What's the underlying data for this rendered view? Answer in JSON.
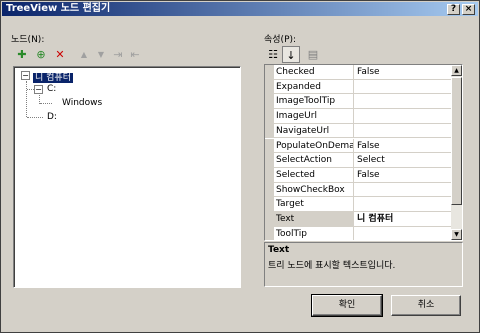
{
  "window": {
    "title": "TreeView 노드 편집기",
    "help_glyph": "?",
    "close_glyph": "×"
  },
  "nodes_panel": {
    "label": "노드(N):",
    "toolbar": [
      {
        "name": "add-root-icon",
        "glyph": "✚"
      },
      {
        "name": "add-child-icon",
        "glyph": "⊕"
      },
      {
        "name": "delete-icon",
        "glyph": "✕"
      },
      {
        "name": "move-up-icon",
        "glyph": "▲"
      },
      {
        "name": "move-down-icon",
        "glyph": "▼"
      },
      {
        "name": "indent-icon",
        "glyph": "⇥"
      },
      {
        "name": "outdent-icon",
        "glyph": "⇤"
      }
    ],
    "tree": {
      "root": "니 컴퓨터",
      "child1": "C:",
      "grandchild": "Windows",
      "child2": "D:"
    }
  },
  "props_panel": {
    "label": "속성(P):",
    "toolbar": [
      {
        "name": "categorized-icon",
        "glyph": "☷"
      },
      {
        "name": "alphabetical-icon",
        "glyph": "↓"
      },
      {
        "name": "property-pages-icon",
        "glyph": "▤"
      }
    ],
    "rows": [
      {
        "name": "Checked",
        "value": "False"
      },
      {
        "name": "Expanded",
        "value": ""
      },
      {
        "name": "ImageToolTip",
        "value": ""
      },
      {
        "name": "ImageUrl",
        "value": ""
      },
      {
        "name": "NavigateUrl",
        "value": ""
      },
      {
        "name": "PopulateOnDemar",
        "value": "False"
      },
      {
        "name": "SelectAction",
        "value": "Select"
      },
      {
        "name": "Selected",
        "value": "False"
      },
      {
        "name": "ShowCheckBox",
        "value": ""
      },
      {
        "name": "Target",
        "value": ""
      },
      {
        "name": "Text",
        "value": "니 컴퓨터"
      },
      {
        "name": "ToolTip",
        "value": ""
      }
    ],
    "selected_row": 10,
    "description": {
      "title": "Text",
      "body": "트리 노드에 표시할 텍스트입니다."
    }
  },
  "buttons": {
    "ok": "확인",
    "cancel": "취소"
  },
  "colors": {
    "selection": "#0a246a",
    "delete_icon": "#cc0000",
    "add_icon": "#2a8a2a"
  }
}
